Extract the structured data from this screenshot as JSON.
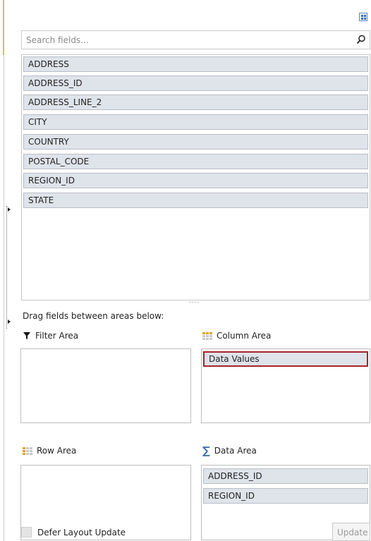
{
  "search": {
    "placeholder": "Search fields..."
  },
  "fields": [
    "ADDRESS",
    "ADDRESS_ID",
    "ADDRESS_LINE_2",
    "CITY",
    "COUNTRY",
    "POSTAL_CODE",
    "REGION_ID",
    "STATE"
  ],
  "hint": "Drag fields between areas below:",
  "areas": {
    "filter": {
      "label": "Filter Area",
      "icon": "filter-icon",
      "items": []
    },
    "column": {
      "label": "Column Area",
      "icon": "column-grid-icon",
      "items": [
        "Data Values"
      ]
    },
    "row": {
      "label": "Row Area",
      "icon": "row-grid-icon",
      "items": []
    },
    "data": {
      "label": "Data Area",
      "icon": "sigma-icon",
      "items": [
        "ADDRESS_ID",
        "REGION_ID"
      ]
    }
  },
  "footer": {
    "defer_label": "Defer Layout Update",
    "update_label": "Update",
    "defer_checked": false
  },
  "colors": {
    "selected_border": "#a8232c",
    "field_bg": "#dfe3ea",
    "accent": "#3d73b7",
    "grid_icon": "#e0a42a"
  }
}
